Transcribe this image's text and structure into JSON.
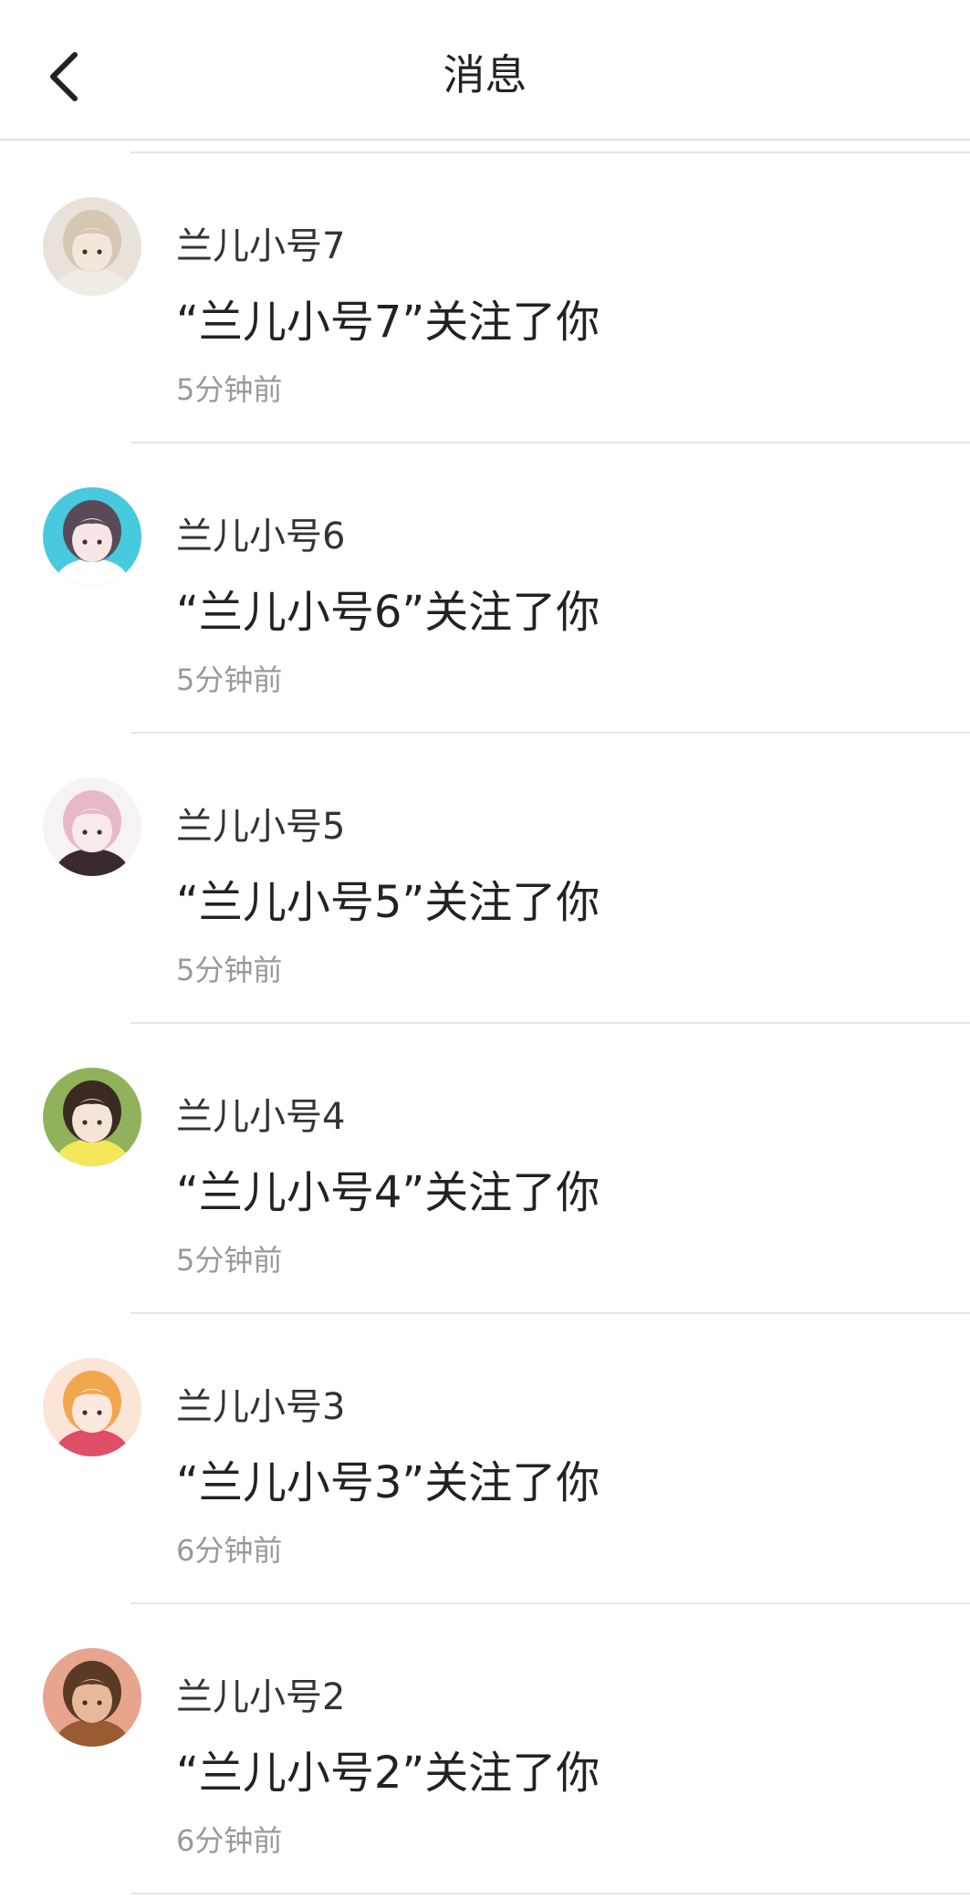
{
  "header": {
    "title": "消息",
    "back_icon": "chevron-left-icon"
  },
  "messages": [
    {
      "name": "兰儿小号7",
      "text": "“兰儿小号7”关注了你",
      "time": "5分钟前",
      "avatar": {
        "bg": "#e8e2da",
        "hair": "#d6c7b2",
        "skin": "#f3e7dc",
        "accent": "#f0ece6"
      }
    },
    {
      "name": "兰儿小号6",
      "text": "“兰儿小号6”关注了你",
      "time": "5分钟前",
      "avatar": {
        "bg": "#47c9de",
        "hair": "#5a4a58",
        "skin": "#f6e6e4",
        "accent": "#ffffff"
      }
    },
    {
      "name": "兰儿小号5",
      "text": "“兰儿小号5”关注了你",
      "time": "5分钟前",
      "avatar": {
        "bg": "#f7f2f3",
        "hair": "#e7b9c8",
        "skin": "#f8e9ea",
        "accent": "#3a2a30"
      }
    },
    {
      "name": "兰儿小号4",
      "text": "“兰儿小号4”关注了你",
      "time": "5分钟前",
      "avatar": {
        "bg": "#8fb25a",
        "hair": "#3a2b22",
        "skin": "#f6e4d6",
        "accent": "#f4e85a"
      }
    },
    {
      "name": "兰儿小号3",
      "text": "“兰儿小号3”关注了你",
      "time": "6分钟前",
      "avatar": {
        "bg": "#fbe5d7",
        "hair": "#f2a74f",
        "skin": "#fbe9df",
        "accent": "#e04d66"
      }
    },
    {
      "name": "兰儿小号2",
      "text": "“兰儿小号2”关注了你",
      "time": "6分钟前",
      "avatar": {
        "bg": "#e7a58e",
        "hair": "#5b3a25",
        "skin": "#e8b89a",
        "accent": "#9a5a32"
      }
    }
  ]
}
